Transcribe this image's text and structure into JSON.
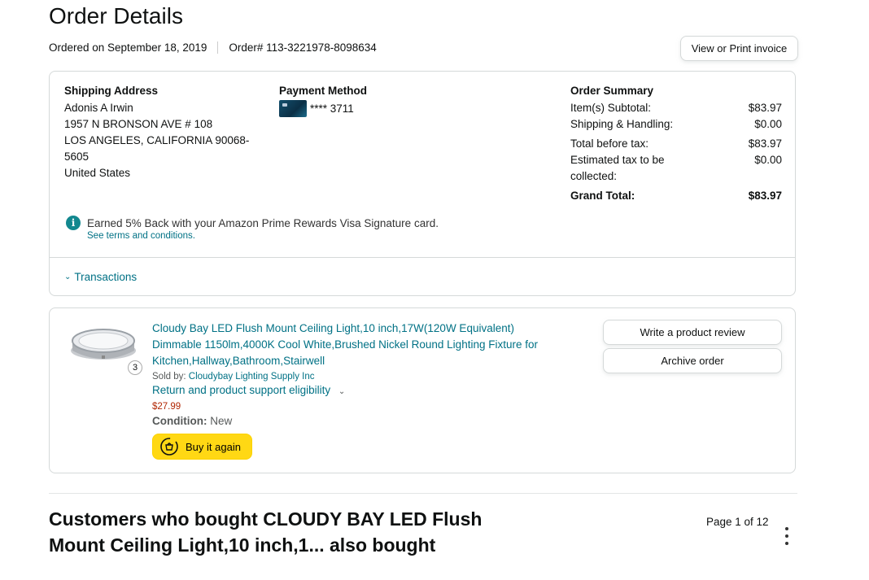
{
  "page_title": "Order Details",
  "ordered_on": "Ordered on September 18, 2019",
  "order_number": "Order# 113-3221978-8098634",
  "invoice_button": "View or Print invoice",
  "shipping": {
    "heading": "Shipping Address",
    "name": "Adonis A Irwin",
    "line1": "1957 N BRONSON AVE # 108",
    "line2": "LOS ANGELES, CALIFORNIA 90068-",
    "line3": "5605",
    "country": "United States"
  },
  "payment": {
    "heading": "Payment Method",
    "card": "**** 3711"
  },
  "summary": {
    "heading": "Order Summary",
    "subtotal_label": "Item(s) Subtotal:",
    "subtotal_value": "$83.97",
    "shipping_label": "Shipping & Handling:",
    "shipping_value": "$0.00",
    "before_tax_label": "Total before tax:",
    "before_tax_value": "$83.97",
    "tax_label_1": "Estimated tax to be",
    "tax_label_2": "collected:",
    "tax_value": "$0.00",
    "grand_label": "Grand Total:",
    "grand_value": "$83.97"
  },
  "rewards": {
    "text": "Earned 5% Back with your Amazon Prime Rewards Visa Signature card.",
    "link": "See terms and conditions."
  },
  "transactions_label": "Transactions",
  "product": {
    "title_line1": "Cloudy Bay LED Flush Mount Ceiling Light,10 inch,17W(120W Equivalent)",
    "title_line2": "Dimmable 1150lm,4000K Cool White,Brushed Nickel Round Lighting Fixture for",
    "title_line3": "Kitchen,Hallway,Bathroom,Stairwell",
    "quantity": "3",
    "sold_by_label": "Sold by:",
    "seller": "Cloudybay Lighting Supply Inc",
    "return_link": "Return and product support eligibility",
    "price": "$27.99",
    "condition_label": "Condition:",
    "condition_value": "New",
    "buy_again": "Buy it again",
    "write_review": "Write a product review",
    "archive": "Archive order"
  },
  "also_bought": {
    "line1": "Customers who bought CLOUDY BAY LED Flush",
    "line2": "Mount Ceiling Light,10 inch,1... also bought",
    "page": "Page 1 of 12"
  },
  "colors": {
    "link": "#007185",
    "price": "#b12704",
    "buy_button": "#ffd814",
    "info_icon": "#12888f"
  }
}
